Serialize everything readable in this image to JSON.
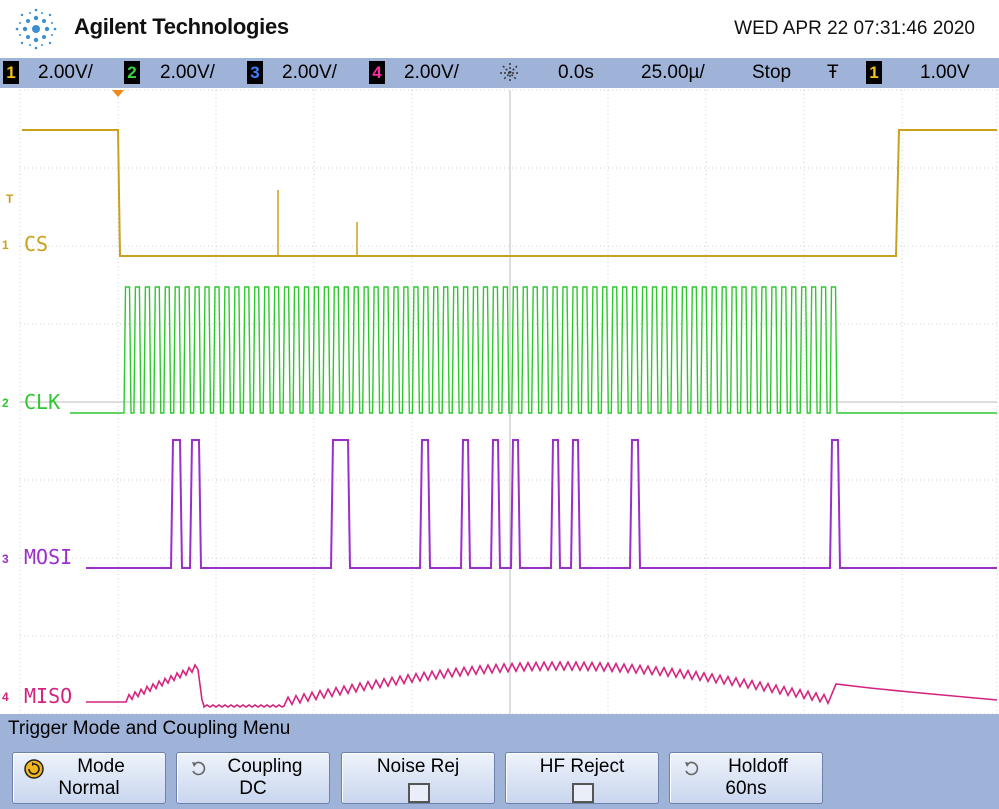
{
  "header": {
    "brand": "Agilent Technologies",
    "datetime": "WED APR 22 07:31:46 2020",
    "logo_icon": "agilent-spark-icon"
  },
  "status": {
    "channels": [
      {
        "num": "1",
        "scale": "2.00V/",
        "color": "#f2c21b"
      },
      {
        "num": "2",
        "scale": "2.00V/",
        "color": "#3cd63c"
      },
      {
        "num": "3",
        "scale": "2.00V/",
        "color": "#3f7fff"
      },
      {
        "num": "4",
        "scale": "2.00V/",
        "color": "#ff2aa0"
      }
    ],
    "delay": "0.0s",
    "timebase": "25.00µ/",
    "run_state": "Stop",
    "trigger_slope_glyph": "Ŧ",
    "trigger_source": "1",
    "trigger_level": "1.00V"
  },
  "traces": {
    "cs": {
      "label": "CS",
      "marker": "1",
      "color": "#c8a21a"
    },
    "clk": {
      "label": "CLK",
      "marker": "2",
      "color": "#2ec82e"
    },
    "mosi": {
      "label": "MOSI",
      "marker": "3",
      "color": "#9b2fc9"
    },
    "miso": {
      "label": "MISO",
      "marker": "4",
      "color": "#d4237e"
    },
    "trigger_marker": "T"
  },
  "menu": {
    "title": "Trigger Mode and Coupling Menu",
    "keys": [
      {
        "line1": "Mode",
        "line2": "Normal",
        "icon": "rotate-knob-icon"
      },
      {
        "line1": "Coupling",
        "line2": "DC",
        "icon": "rotate-arrow-icon"
      },
      {
        "line1": "Noise Rej",
        "line2": "",
        "checkbox": false
      },
      {
        "line1": "HF Reject",
        "line2": "",
        "checkbox": false
      },
      {
        "line1": "Holdoff",
        "line2": "60ns",
        "icon": "rotate-arrow-icon"
      }
    ]
  }
}
